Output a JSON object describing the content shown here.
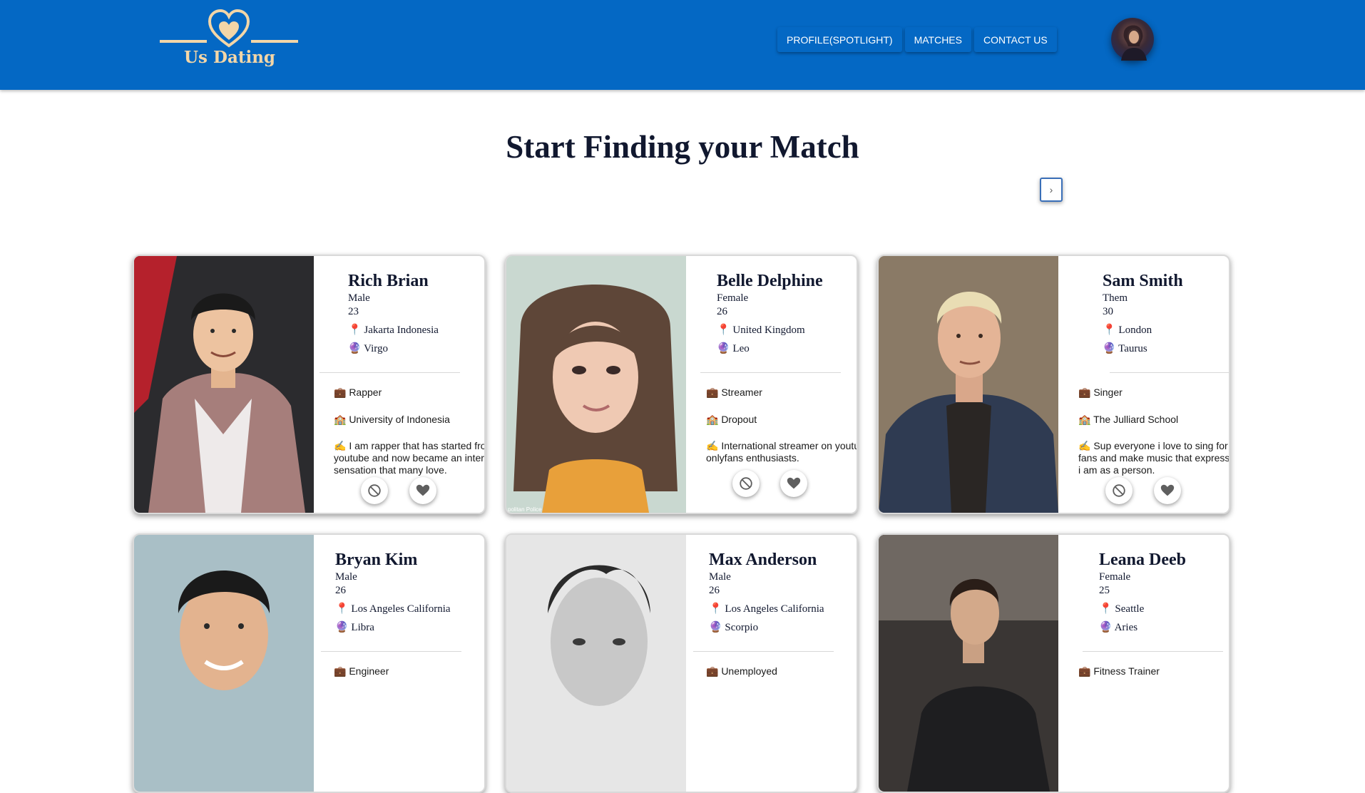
{
  "app": {
    "name": "Us Dating"
  },
  "nav": {
    "items": [
      {
        "label": "PROFILE(SPOTLIGHT)"
      },
      {
        "label": "MATCHES"
      },
      {
        "label": "CONTACT US"
      }
    ]
  },
  "main": {
    "title": "Start Finding your Match",
    "next_arrow": "›"
  },
  "profiles": [
    {
      "name": "Rich Brian",
      "gender": "Male",
      "age": "23",
      "location": "📍 Jakarta Indonesia",
      "sign": "🔮 Virgo",
      "job": "💼 Rapper",
      "school": "🏫 University of Indonesia",
      "bio": "✍️ I am rapper that has started from youtube and now became an internet sensation that many love."
    },
    {
      "name": "Belle Delphine",
      "gender": "Female",
      "age": "26",
      "location": "📍 United Kingdom",
      "sign": "🔮 Leo",
      "job": "💼 Streamer",
      "school": "🏫 Dropout",
      "bio": "✍️ International streamer on youtube and onlyfans enthusiasts.",
      "photo_credit": "politan Police"
    },
    {
      "name": "Sam Smith",
      "gender": "Them",
      "age": "30",
      "location": "📍 London",
      "sign": "🔮 Taurus",
      "job": "💼 Singer",
      "school": "🏫 The Julliard School",
      "bio": "✍️ Sup everyone i love to sing for my fans and make music that expresses who i am as a person."
    },
    {
      "name": "Bryan Kim",
      "gender": "Male",
      "age": "26",
      "location": "📍 Los Angeles California",
      "sign": "🔮 Libra",
      "job": "💼 Engineer"
    },
    {
      "name": "Max Anderson",
      "gender": "Male",
      "age": "26",
      "location": "📍 Los Angeles California",
      "sign": "🔮 Scorpio",
      "job": "💼 Unemployed"
    },
    {
      "name": "Leana Deeb",
      "gender": "Female",
      "age": "25",
      "location": "📍 Seattle",
      "sign": "🔮 Aries",
      "job": "💼 Fitness Trainer"
    }
  ],
  "icons": {
    "reject": "block-icon",
    "like": "heart-icon"
  },
  "colors": {
    "header": "#0468c4",
    "logo": "#f3d6a7",
    "title": "#11182f"
  }
}
